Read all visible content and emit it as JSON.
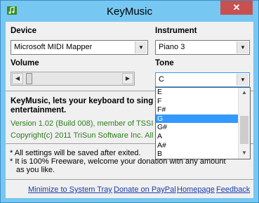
{
  "window": {
    "title": "KeyMusic",
    "close_label": "✕"
  },
  "device": {
    "label": "Device",
    "value": "Microsoft MIDI Mapper"
  },
  "instrument": {
    "label": "Instrument",
    "value": "Piano 3"
  },
  "volume": {
    "label": "Volume",
    "level": 0.03
  },
  "tone": {
    "label": "Tone",
    "value": "C",
    "options": [
      "E",
      "F",
      "F#",
      "G",
      "G#",
      "A",
      "A#",
      "B"
    ],
    "highlighted": "G"
  },
  "about": {
    "description": "KeyMusic, lets your keyboard to sing",
    "description_cont": "entertainment.",
    "version": "Version 1.02 (Build 008), member of TSSI P",
    "copyright": "Copyright(c) 2011 TriSun Software Inc. All"
  },
  "notes": {
    "line1": "* All settings will be saved after exited.",
    "line2": "* It is 100% Freeware, welcome your donation with any amount",
    "line3": "as you like."
  },
  "links": {
    "minimize": "Minimize to System Tray",
    "donate": "Donate on PayPal",
    "homepage": "Homepage",
    "feedback": "Feedback"
  },
  "colors": {
    "titlebar": "#76c7f1",
    "selection": "#3399ff",
    "green_text": "#2d7d1c",
    "link": "#1a3cb0",
    "close": "#c75050"
  }
}
